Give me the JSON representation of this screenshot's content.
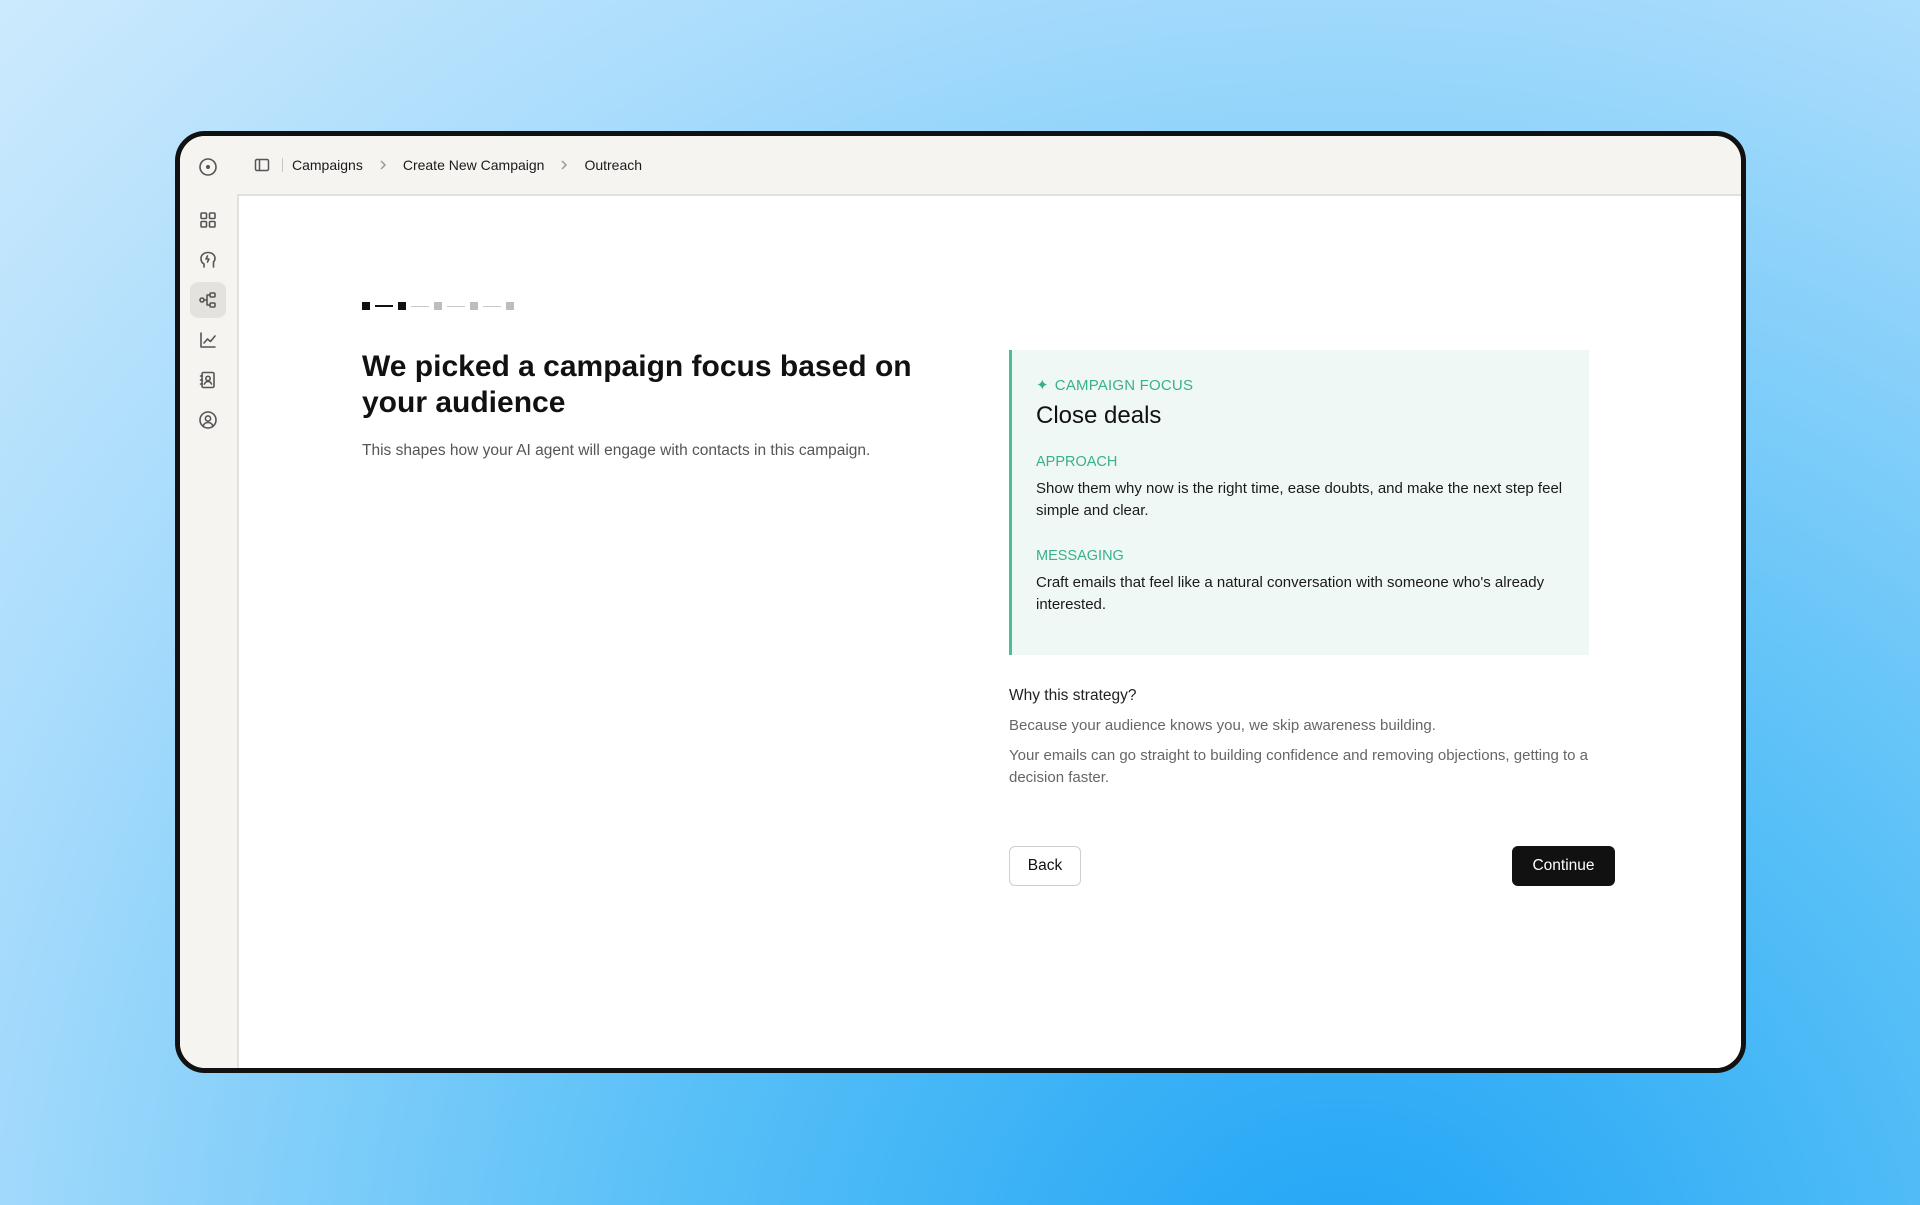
{
  "breadcrumb": {
    "items": [
      "Campaigns",
      "Create New Campaign",
      "Outreach"
    ]
  },
  "sidebar": {
    "icons": [
      "logo-icon",
      "dashboard-icon",
      "ai-brain-icon",
      "workflow-icon",
      "analytics-icon",
      "contacts-icon",
      "profile-icon"
    ],
    "active": "workflow-icon"
  },
  "progress": {
    "total_steps": 5,
    "completed_steps": 2
  },
  "page": {
    "title": "We picked a campaign focus based on your audience",
    "subtitle": "This shapes how your AI agent will engage with contacts in this campaign."
  },
  "focus_card": {
    "tag": "CAMPAIGN FOCUS",
    "title": "Close deals",
    "approach_label": "APPROACH",
    "approach_text": "Show them why now is the right time, ease doubts, and make the next step feel simple and clear.",
    "messaging_label": "MESSAGING",
    "messaging_text": "Craft emails that feel like a natural conversation with someone who's already interested."
  },
  "why": {
    "title": "Why this strategy?",
    "p1": "Because your audience knows you, we skip awareness building.",
    "p2": "Your emails can go straight to building confidence and removing objections, getting to a decision faster."
  },
  "actions": {
    "back": "Back",
    "continue": "Continue"
  },
  "colors": {
    "accent": "#38b08d",
    "card_bg": "#f0f8f5",
    "primary_button": "#111111"
  }
}
